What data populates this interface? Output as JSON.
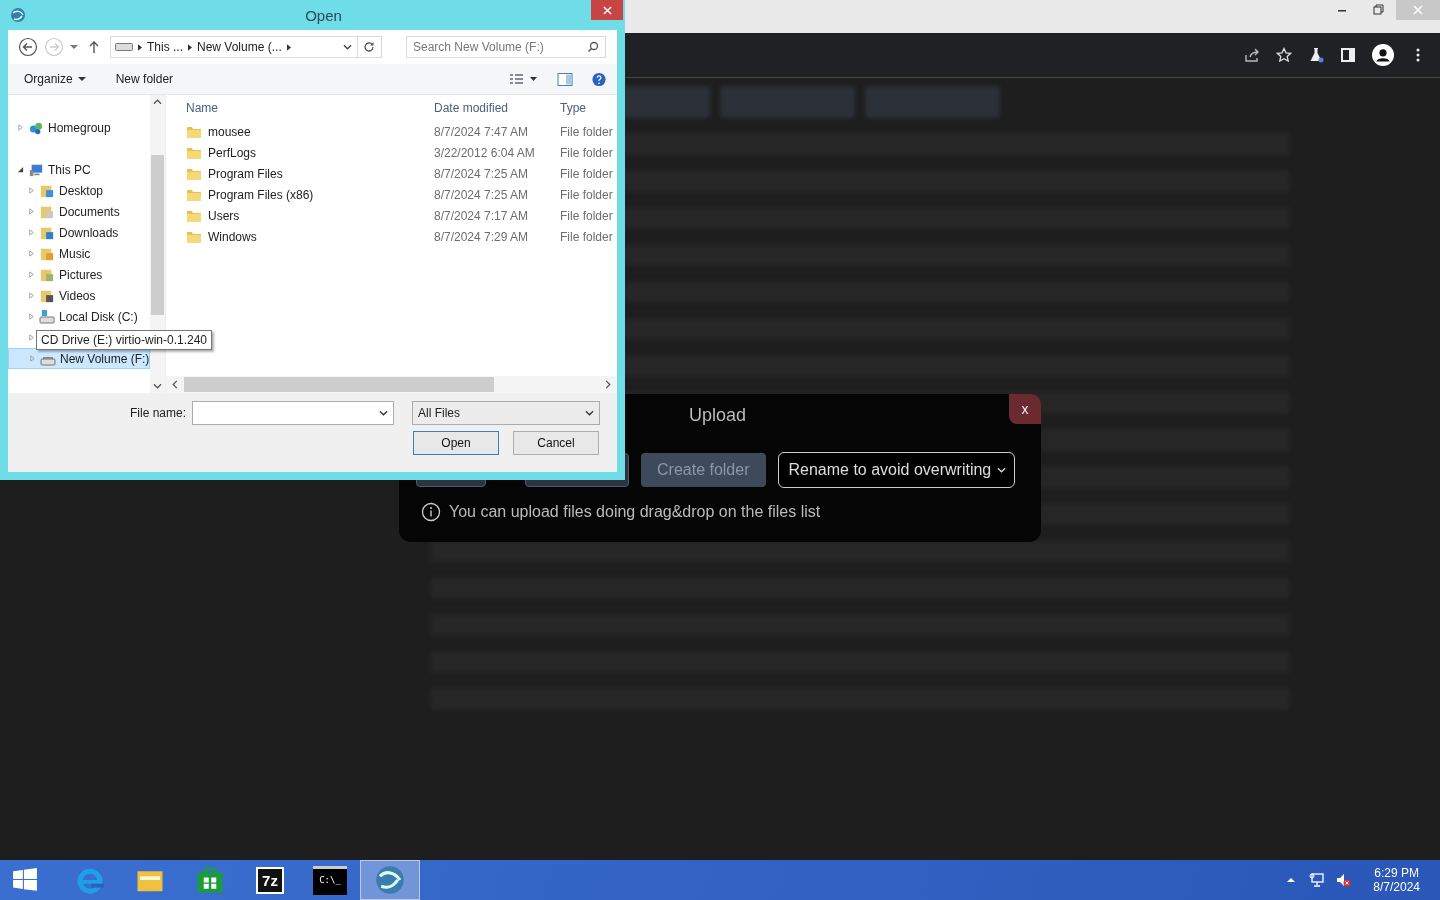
{
  "upload": {
    "title": "Upload",
    "close": "x",
    "create_folder": "Create folder",
    "mode": "Rename to avoid overwriting",
    "hint": "You can upload files doing drag&drop on the files list"
  },
  "dialog": {
    "title": "Open",
    "breadcrumb": [
      "This ...",
      "New Volume (..."
    ],
    "search": {
      "placeholder": "Search New Volume (F:)"
    },
    "toolbar": [
      "Organize",
      "New folder"
    ],
    "nav_tree": [
      {
        "label": "Homegroup",
        "kind": "homegroup",
        "expanded": false,
        "selected": false
      },
      {
        "label": "This PC",
        "kind": "pc",
        "expanded": true,
        "selected": false,
        "children": [
          {
            "label": "Desktop",
            "kind": "desktop",
            "selected": false
          },
          {
            "label": "Documents",
            "kind": "documents",
            "selected": false
          },
          {
            "label": "Downloads",
            "kind": "downloads",
            "selected": false
          },
          {
            "label": "Music",
            "kind": "music",
            "selected": false
          },
          {
            "label": "Pictures",
            "kind": "pictures",
            "selected": false
          },
          {
            "label": "Videos",
            "kind": "videos",
            "selected": false
          },
          {
            "label": "Local Disk (C:)",
            "kind": "disk",
            "selected": false
          },
          {
            "kind": "cd",
            "selected": false
          },
          {
            "label": "New Volume (F:)",
            "kind": "volume",
            "selected": true
          }
        ]
      }
    ],
    "tooltip": "CD Drive (E:) virtio-win-0.1.240",
    "columns": [
      "Name",
      "Date modified",
      "Type"
    ],
    "files": [
      {
        "name": "mousee",
        "date": "8/7/2024 7:47 AM",
        "type": "File folder"
      },
      {
        "name": "PerfLogs",
        "date": "3/22/2012 6:04 AM",
        "type": "File folder"
      },
      {
        "name": "Program Files",
        "date": "8/7/2024 7:25 AM",
        "type": "File folder"
      },
      {
        "name": "Program Files (x86)",
        "date": "8/7/2024 7:25 AM",
        "type": "File folder"
      },
      {
        "name": "Users",
        "date": "8/7/2024 7:17 AM",
        "type": "File folder"
      },
      {
        "name": "Windows",
        "date": "8/7/2024 7:29 AM",
        "type": "File folder"
      }
    ],
    "file_name_label": "File name:",
    "file_type": "All Files",
    "buttons": [
      "Open",
      "Cancel"
    ]
  },
  "taskbar": {
    "apps": [
      {
        "kind": "ie",
        "selected": false
      },
      {
        "kind": "explorer",
        "selected": false
      },
      {
        "kind": "store",
        "selected": false
      },
      {
        "kind": "archiver",
        "label": "7z",
        "selected": false
      },
      {
        "kind": "cmd",
        "label": "C:\\_",
        "selected": false
      },
      {
        "kind": "globe",
        "selected": true
      }
    ],
    "time": "6:29 PM",
    "date": "8/7/2024"
  }
}
